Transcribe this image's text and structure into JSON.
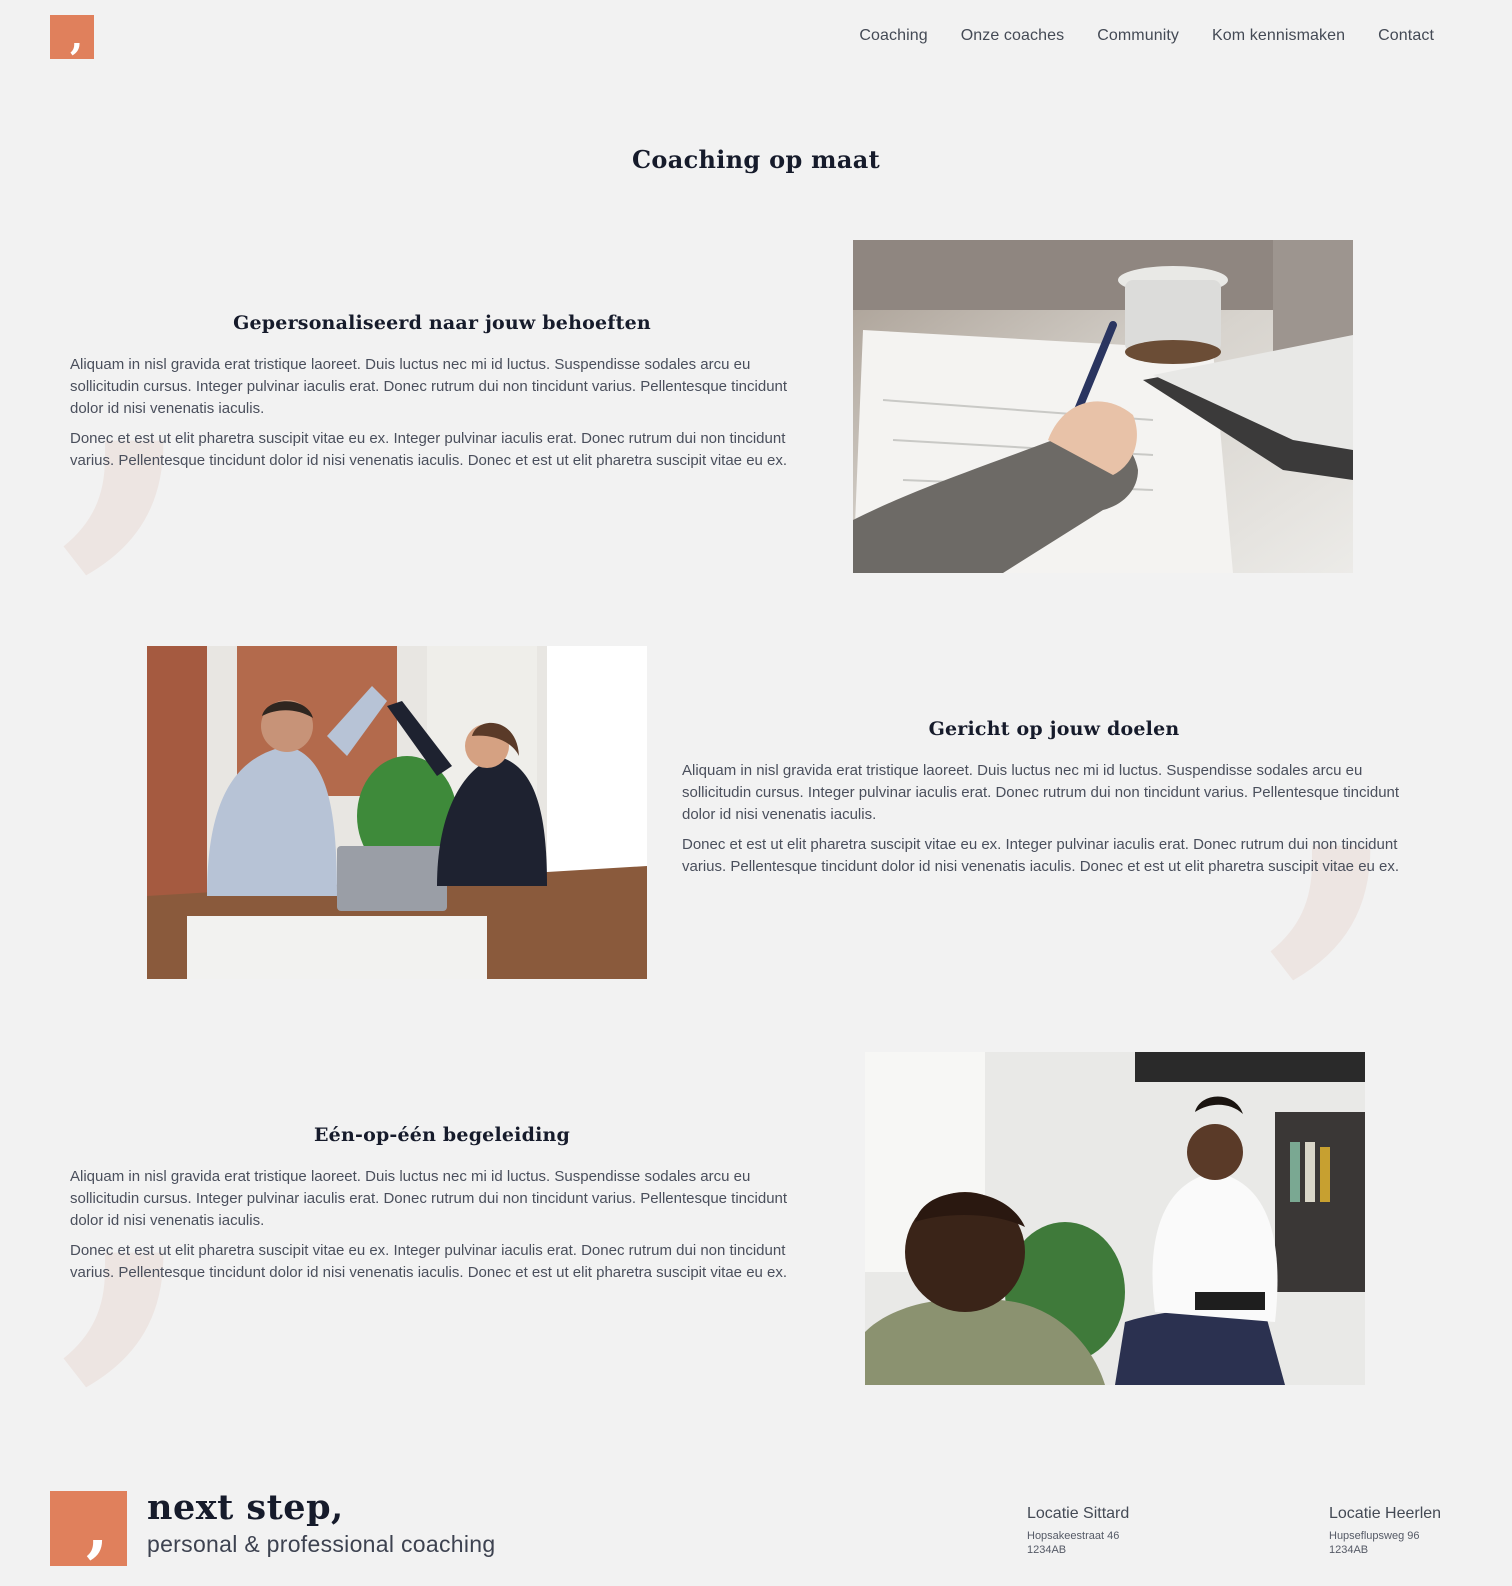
{
  "header": {
    "logo_alt": "next step logo",
    "nav": [
      "Coaching",
      "Onze coaches",
      "Community",
      "Kom kennismaken",
      "Contact"
    ]
  },
  "main": {
    "title": "Coaching op maat",
    "sections": [
      {
        "heading": "Gepersonaliseerd naar jouw behoeften",
        "p1": "Aliquam in nisl gravida erat tristique laoreet. Duis luctus nec mi id luctus. Suspendisse sodales arcu eu sollicitudin cursus. Integer pulvinar iaculis erat. Donec rutrum dui non tincidunt varius. Pellentesque tincidunt dolor id nisi venenatis iaculis.",
        "p2": "Donec et est ut elit pharetra suscipit vitae eu ex. Integer pulvinar iaculis erat. Donec rutrum dui non tincidunt varius. Pellentesque tincidunt dolor id nisi venenatis iaculis. Donec et est ut elit pharetra suscipit vitae eu ex.",
        "image": "person-writing-notes-photo"
      },
      {
        "heading": "Gericht op jouw doelen",
        "p1": "Aliquam in nisl gravida erat tristique laoreet. Duis luctus nec mi id luctus. Suspendisse sodales arcu eu sollicitudin cursus. Integer pulvinar iaculis erat. Donec rutrum dui non tincidunt varius. Pellentesque tincidunt dolor id nisi venenatis iaculis.",
        "p2": "Donec et est ut elit pharetra suscipit vitae eu ex. Integer pulvinar iaculis erat. Donec rutrum dui non tincidunt varius. Pellentesque tincidunt dolor id nisi venenatis iaculis. Donec et est ut elit pharetra suscipit vitae eu ex.",
        "image": "high-five-office-photo"
      },
      {
        "heading": "Eén-op-één begeleiding",
        "p1": "Aliquam in nisl gravida erat tristique laoreet. Duis luctus nec mi id luctus. Suspendisse sodales arcu eu sollicitudin cursus. Integer pulvinar iaculis erat. Donec rutrum dui non tincidunt varius. Pellentesque tincidunt dolor id nisi venenatis iaculis.",
        "p2": "Donec et est ut elit pharetra suscipit vitae eu ex. Integer pulvinar iaculis erat. Donec rutrum dui non tincidunt varius. Pellentesque tincidunt dolor id nisi venenatis iaculis. Donec et est ut elit pharetra suscipit vitae eu ex.",
        "image": "coaching-session-photo"
      }
    ]
  },
  "footer": {
    "brand_name": "next step,",
    "tagline": "personal & professional coaching",
    "locations": [
      {
        "title": "Locatie Sittard",
        "street": "Hopsakeestraat 46",
        "postcode": "1234AB"
      },
      {
        "title": "Locatie Heerlen",
        "street": "Hupseflupsweg 96",
        "postcode": "1234AB"
      }
    ]
  },
  "colors": {
    "accent": "#e0805c",
    "background": "#f2f2f2",
    "heading": "#161b2b",
    "decorative_comma": "#ede5e2"
  }
}
